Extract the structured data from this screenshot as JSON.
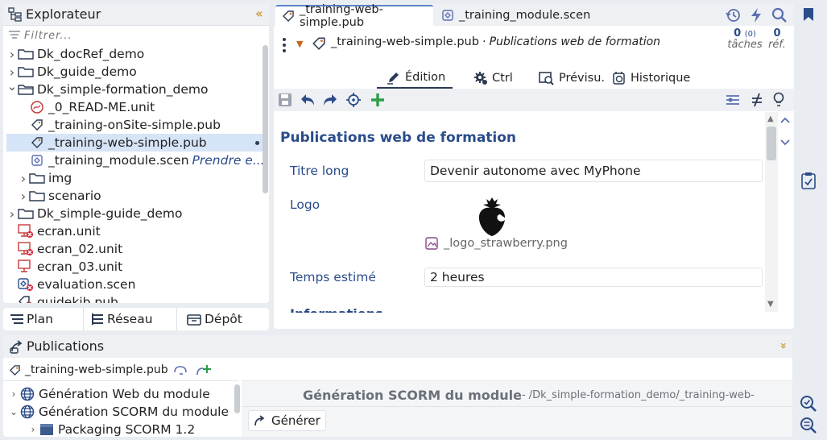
{
  "explorer": {
    "title": "Explorateur",
    "collapse_glyph": "«",
    "filter_placeholder": "Filtrer...",
    "items": [
      {
        "label": "Dk_docRef_demo",
        "icon": "folder-icon",
        "chev": "›",
        "indent": 0
      },
      {
        "label": "Dk_guide_demo",
        "icon": "folder-icon",
        "chev": "›",
        "indent": 0
      },
      {
        "label": "Dk_simple-formation_demo",
        "icon": "folder-open-icon",
        "chev": "⌄",
        "indent": 0
      },
      {
        "label": "_0_READ-ME.unit",
        "icon": "readme-unit-icon",
        "chev": "",
        "indent": 1
      },
      {
        "label": "_training-onSite-simple.pub",
        "icon": "pub-icon",
        "chev": "",
        "indent": 1
      },
      {
        "label": "_training-web-simple.pub",
        "icon": "pub-icon",
        "chev": "",
        "indent": 1,
        "selected": true
      },
      {
        "label": "_training_module.scen",
        "icon": "scen-icon",
        "chev": "",
        "indent": 1,
        "note": "Prendre e..."
      },
      {
        "label": "img",
        "icon": "folder-icon",
        "chev": "›",
        "indent": 1
      },
      {
        "label": "scenario",
        "icon": "folder-icon",
        "chev": "›",
        "indent": 1
      },
      {
        "label": "Dk_simple-guide_demo",
        "icon": "folder-icon",
        "chev": "›",
        "indent": 0
      },
      {
        "label": "ecran.unit",
        "icon": "screen-error-icon",
        "chev": "",
        "indent": 0
      },
      {
        "label": "ecran_02.unit",
        "icon": "screen-error-icon",
        "chev": "",
        "indent": 0
      },
      {
        "label": "ecran_03.unit",
        "icon": "screen-icon",
        "chev": "",
        "indent": 0
      },
      {
        "label": "evaluation.scen",
        "icon": "scen-error-icon",
        "chev": "",
        "indent": 0
      },
      {
        "label": "guidekib.pub",
        "icon": "pub-error-icon",
        "chev": "",
        "indent": 0
      }
    ]
  },
  "nav_tabs": [
    {
      "label": "Plan",
      "icon": "plan-icon"
    },
    {
      "label": "Réseau",
      "icon": "network-icon"
    },
    {
      "label": "Dépôt",
      "icon": "repository-icon"
    }
  ],
  "editor": {
    "tabs": [
      {
        "label": "_training-web-simple.pub",
        "icon": "pub-icon",
        "active": true
      },
      {
        "label": "_training_module.scen",
        "icon": "scen-icon",
        "active": false
      }
    ],
    "header": {
      "filename": "_training-web-simple.pub",
      "separator": "·",
      "type_label": "Publications web de formation",
      "tasks_count": "0",
      "tasks_sub": "(0)",
      "tasks_label": "tâches",
      "refs_count": "0",
      "refs_label": "réf."
    },
    "subtabs": [
      {
        "label": "Édition",
        "icon": "pen-icon",
        "active": true
      },
      {
        "label": "Ctrl",
        "icon": "gear-icon",
        "active": false
      },
      {
        "label": "Prévisu.",
        "icon": "preview-icon",
        "active": false
      },
      {
        "label": "Historique",
        "icon": "history-icon",
        "active": false
      }
    ],
    "form": {
      "title": "Publications web de formation",
      "fields": [
        {
          "label": "Titre long",
          "value": "Devenir autonome avec MyPhone"
        },
        {
          "label": "Logo",
          "image_name": "_logo_strawberry.png"
        },
        {
          "label": "Temps estimé",
          "value": "2 heures"
        }
      ],
      "next_section_partial": "Informations"
    }
  },
  "publications": {
    "title": "Publications",
    "collapse_glyph": "»",
    "pub_tab": "_training-web-simple.pub",
    "tree": [
      {
        "label": "Génération Web du module",
        "chev": "›",
        "icon": "globe-icon",
        "indent": 0
      },
      {
        "label": "Génération SCORM du module",
        "chev": "⌄",
        "icon": "globe-icon",
        "indent": 0
      },
      {
        "label": "Packaging SCORM 1.2",
        "chev": "›",
        "icon": "package-icon",
        "indent": 1
      }
    ],
    "detail_title": "Génération SCORM du module",
    "detail_path": " - /Dk_simple-formation_demo/_training-web-",
    "generate_label": "Générer"
  },
  "colors": {
    "accent_blue": "#2a4c8a",
    "selection": "#d6e4f7",
    "error_red": "#d6223a",
    "green": "#2e9e4a",
    "background": "#e9ecf0"
  }
}
